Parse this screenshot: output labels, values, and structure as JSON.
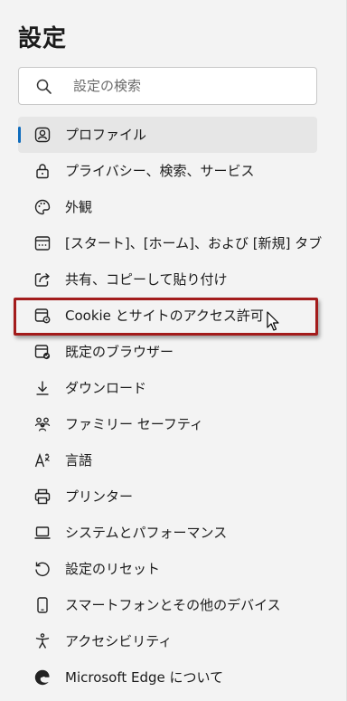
{
  "page": {
    "title": "設定"
  },
  "search": {
    "placeholder": "設定の検索",
    "value": ""
  },
  "colors": {
    "accent": "#0f6cbd",
    "highlight_border": "#a31c1c",
    "selected_bg": "#e6e6e6"
  },
  "nav": {
    "items": [
      {
        "label": "プロファイル",
        "icon": "profile-icon",
        "selected": true
      },
      {
        "label": "プライバシー、検索、サービス",
        "icon": "lock-icon"
      },
      {
        "label": "外観",
        "icon": "palette-icon"
      },
      {
        "label": "[スタート]、[ホーム]、および [新規] タブ",
        "icon": "start-page-icon"
      },
      {
        "label": "共有、コピーして貼り付け",
        "icon": "share-icon"
      },
      {
        "label": "Cookie とサイトのアクセス許可",
        "icon": "cookie-settings-icon",
        "highlighted": true
      },
      {
        "label": "既定のブラウザー",
        "icon": "default-browser-icon"
      },
      {
        "label": "ダウンロード",
        "icon": "download-icon"
      },
      {
        "label": "ファミリー セーフティ",
        "icon": "family-icon"
      },
      {
        "label": "言語",
        "icon": "language-icon"
      },
      {
        "label": "プリンター",
        "icon": "printer-icon"
      },
      {
        "label": "システムとパフォーマンス",
        "icon": "laptop-icon"
      },
      {
        "label": "設定のリセット",
        "icon": "reset-icon"
      },
      {
        "label": "スマートフォンとその他のデバイス",
        "icon": "phone-icon"
      },
      {
        "label": "アクセシビリティ",
        "icon": "accessibility-icon"
      },
      {
        "label": "Microsoft Edge について",
        "icon": "edge-icon"
      }
    ]
  }
}
